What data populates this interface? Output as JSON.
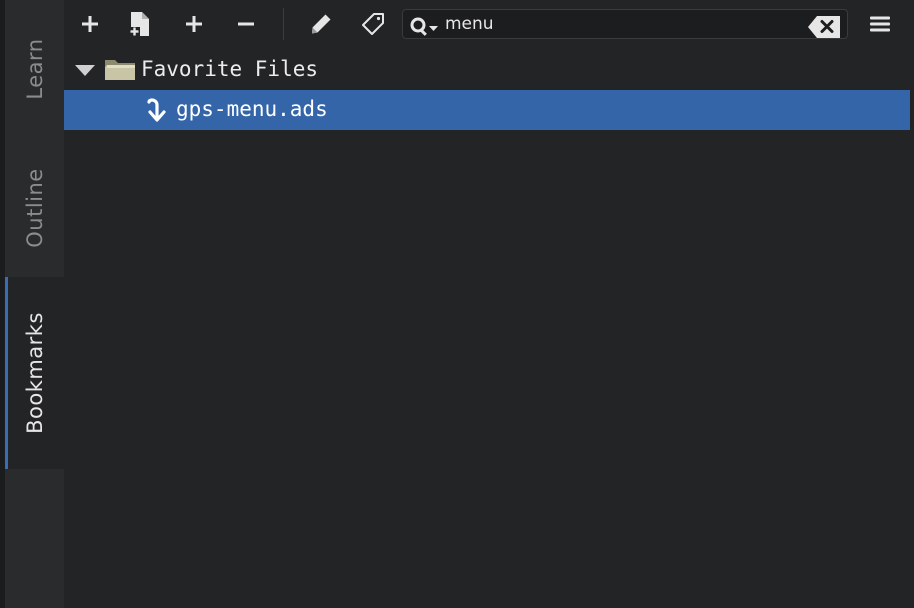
{
  "side_tabs": [
    {
      "label": "Learn",
      "active": false
    },
    {
      "label": "Outline",
      "active": false
    },
    {
      "label": "Bookmarks",
      "active": true
    }
  ],
  "toolbar": {
    "buttons": [
      {
        "icon": "plus-icon",
        "name": "add-bookmark-button"
      },
      {
        "icon": "new-file-icon",
        "name": "new-bookmark-file-button"
      },
      {
        "icon": "plus-icon",
        "name": "expand-button"
      },
      {
        "icon": "minus-icon",
        "name": "collapse-button"
      },
      {
        "icon": "pencil-icon",
        "name": "edit-bookmark-button"
      },
      {
        "icon": "tag-icon",
        "name": "tag-button"
      }
    ],
    "search": {
      "value": "menu",
      "placeholder": "",
      "icon": "search-icon",
      "clear_icon": "clear-icon"
    },
    "menu_icon": "hamburger-menu-icon"
  },
  "tree": {
    "folder": {
      "label": "Favorite Files",
      "expanded": true,
      "icon": "folder-icon"
    },
    "items": [
      {
        "label": "gps-menu.ads",
        "icon": "bookmark-jump-icon",
        "selected": true
      }
    ]
  },
  "colors": {
    "background": "#232425",
    "tab_strip": "#2a2b2c",
    "selection": "#3465a8",
    "text": "#ececec",
    "inactive_tab_text": "#8a8c8e"
  }
}
